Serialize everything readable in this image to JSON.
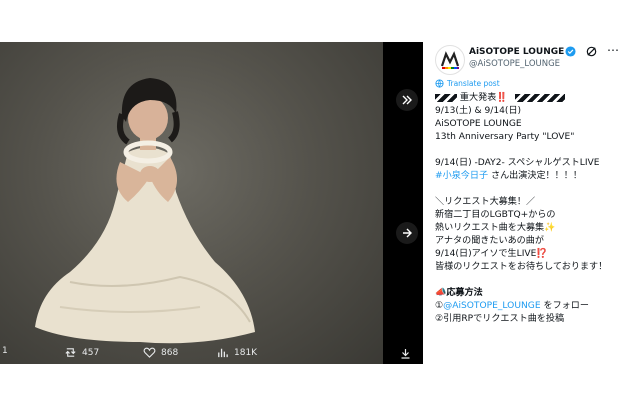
{
  "account": {
    "display_name": "AiSOTOPE LOUNGE",
    "handle": "@AiSOTOPE_LOUNGE"
  },
  "media": {
    "photo_description_icon": "photo",
    "expand_icon": "expand-icon",
    "next_icon": "arrow-right-icon"
  },
  "actions": {
    "reply_count": "1",
    "retweet_count": "457",
    "like_count": "868",
    "views_count": "181K"
  },
  "translate_label": "Translate post",
  "post": {
    "line1": "重大発表",
    "line1_emoji": "‼️",
    "line2": "9/13(土) & 9/14(日)",
    "line3": "AiSOTOPE LOUNGE",
    "line4": "13th Anniversary Party \"LOVE\"",
    "line5": "9/14(日) -DAY2- スペシャルゲストLIVE",
    "line6_link": "#小泉今日子",
    "line6_rest": " さん出演決定！！！！",
    "line7": "＼リクエスト大募集！／",
    "line8": "新宿二丁目のLGBTQ+からの",
    "line9": "熱いリクエスト曲を大募集",
    "line9_emoji": "✨",
    "line10": "アナタの聞きたいあの曲が",
    "line11": "9/14(日)アイソで生LIVE",
    "line11_emoji": "⁉️",
    "line12": "皆様のリクエストをお待ちしております！",
    "line13_emoji": "📣",
    "line13": "応募方法",
    "line14_prefix": "①",
    "line14_link": "@AiSOTOPE_LOUNGE",
    "line14_rest": " をフォロー",
    "line15": "②引用RPでリクエスト曲を投稿"
  },
  "colors": {
    "link": "#1d9bf0",
    "text": "#0f1419",
    "muted": "#536471",
    "media_bg": "#000000"
  }
}
